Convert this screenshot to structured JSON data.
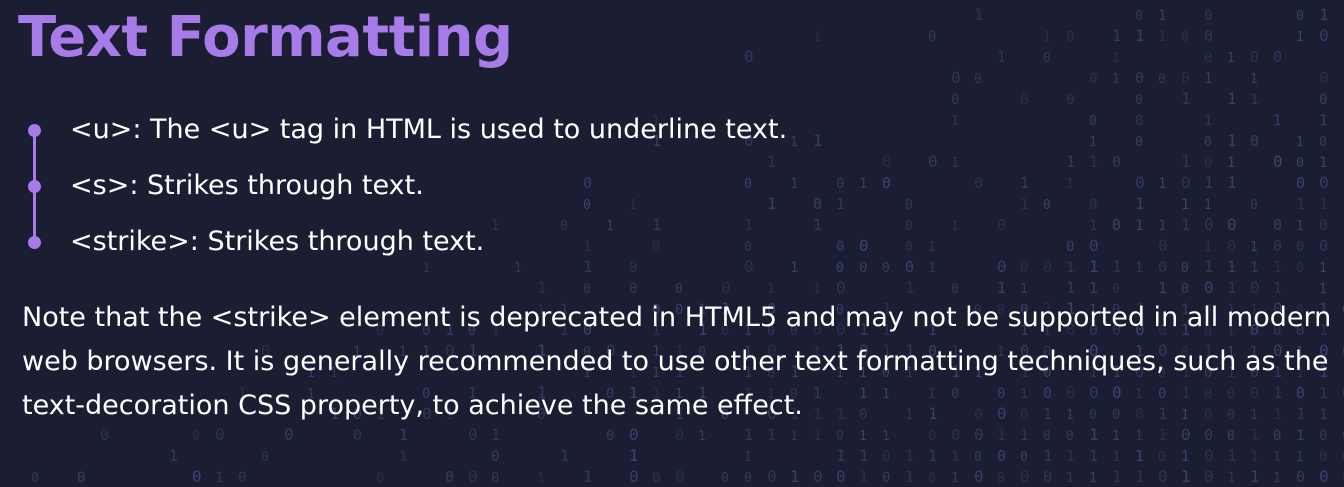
{
  "slide": {
    "title": "Text Formatting",
    "bullets": [
      {
        "text": "<u>: The <u> tag in HTML is used to underline text."
      },
      {
        "text": "<s>: Strikes through text."
      },
      {
        "text": "<strike>: Strikes through text."
      }
    ],
    "note": "Note that the <strike> element is deprecated in HTML5 and may not be supported in all modern web browsers. It is generally recommended to use other text formatting techniques, such as the text-decoration CSS property, to achieve the same effect."
  },
  "colors": {
    "background": "#1b1d33",
    "accent": "#a77be8",
    "text": "#ffffff",
    "matrix_glyphs": "#3a4a78"
  }
}
